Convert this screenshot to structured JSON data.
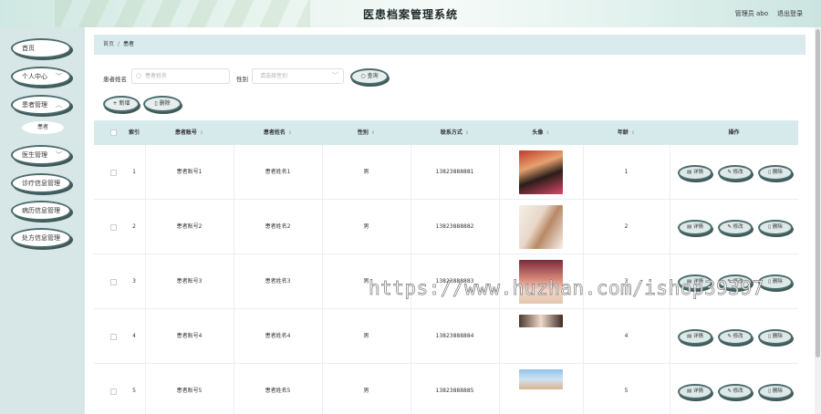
{
  "header": {
    "title": "医患档案管理系统",
    "user_label": "管理员 abo",
    "logout_label": "退出登录"
  },
  "sidebar": {
    "items": [
      {
        "label": "首页",
        "has_children": false
      },
      {
        "label": "个人中心",
        "has_children": true
      },
      {
        "label": "患者管理",
        "has_children": true
      },
      {
        "label": "医生管理",
        "has_children": true
      },
      {
        "label": "诊疗信息管理",
        "has_children": true
      },
      {
        "label": "病历信息管理",
        "has_children": true
      },
      {
        "label": "处方信息管理",
        "has_children": true
      }
    ],
    "submenu_label": "患者"
  },
  "breadcrumb": {
    "home": "首页",
    "separator": "/",
    "current": "患者"
  },
  "search": {
    "name_label": "患者姓名",
    "name_placeholder": "患者姓名",
    "gender_label": "性别",
    "gender_placeholder": "请选择性别",
    "query_label": "查询"
  },
  "toolbar": {
    "add_label": "新增",
    "delete_label": "删除"
  },
  "table": {
    "columns": [
      "索引",
      "患者账号",
      "患者姓名",
      "性别",
      "联系方式",
      "头像",
      "年龄",
      "操作"
    ],
    "rows": [
      {
        "index": "1",
        "account": "患者账号1",
        "name": "患者姓名1",
        "gender": "男",
        "phone": "13823888881",
        "age": "1"
      },
      {
        "index": "2",
        "account": "患者账号2",
        "name": "患者姓名2",
        "gender": "男",
        "phone": "13823888882",
        "age": "2"
      },
      {
        "index": "3",
        "account": "患者账号3",
        "name": "患者姓名3",
        "gender": "男",
        "phone": "13823888883",
        "age": "3"
      },
      {
        "index": "4",
        "account": "患者账号4",
        "name": "患者姓名4",
        "gender": "男",
        "phone": "13823888884",
        "age": "4"
      },
      {
        "index": "5",
        "account": "患者账号5",
        "name": "患者姓名5",
        "gender": "男",
        "phone": "13823888885",
        "age": "5"
      }
    ],
    "row_actions": {
      "detail": "详情",
      "edit": "修改",
      "delete": "删除"
    }
  },
  "watermark": "https://www.huzhan.com/ishop39397",
  "colors": {
    "accent_border": "#4c6b6b",
    "table_header_bg": "#d6eaec",
    "sidebar_bg": "#d7e6e6"
  }
}
